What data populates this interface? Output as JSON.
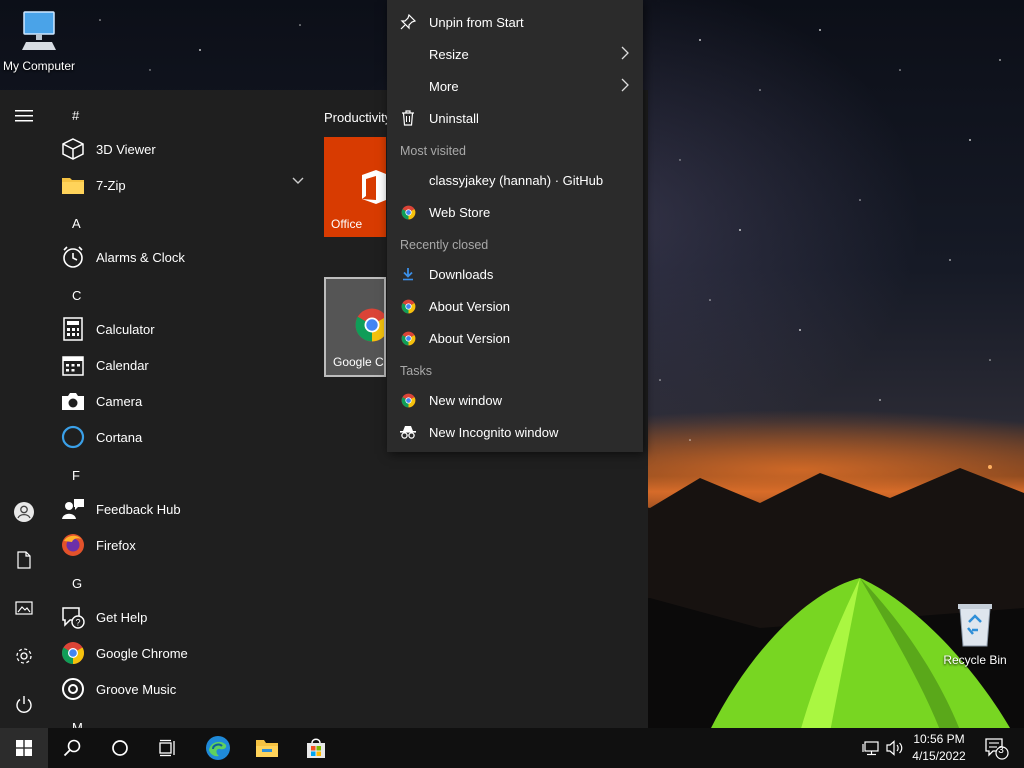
{
  "desktop": {
    "my_computer": "My Computer",
    "recycle_bin": "Recycle Bin"
  },
  "start_menu": {
    "hamburger_icon": "hamburger-menu-icon",
    "rail": [
      "user-icon",
      "document-icon",
      "pictures-icon",
      "settings-icon",
      "power-icon"
    ],
    "groups": {
      "hash": "#",
      "a": "A",
      "c": "C",
      "f": "F",
      "g": "G",
      "m": "M"
    },
    "apps": {
      "viewer3d": "3D Viewer",
      "zip": "7-Zip",
      "alarms": "Alarms & Clock",
      "calculator": "Calculator",
      "calendar": "Calendar",
      "camera": "Camera",
      "cortana": "Cortana",
      "feedback": "Feedback Hub",
      "firefox": "Firefox",
      "gethelp": "Get Help",
      "chrome": "Google Chrome",
      "groove": "Groove Music"
    },
    "tiles_header": "Productivity",
    "tiles": {
      "office": "Office",
      "chrome": "Google Chrome"
    }
  },
  "context_menu": {
    "unpin": "Unpin from Start",
    "resize": "Resize",
    "more": "More",
    "uninstall": "Uninstall",
    "most_visited_header": "Most visited",
    "most_visited": [
      "classyjakey (hannah) · GitHub",
      "Web Store"
    ],
    "recently_closed_header": "Recently closed",
    "recently_closed": [
      "Downloads",
      "About Version",
      "About Version"
    ],
    "tasks_header": "Tasks",
    "tasks": [
      "New window",
      "New Incognito window"
    ]
  },
  "taskbar": {
    "pinned": [
      "start-icon",
      "search-icon",
      "cortana-icon",
      "task-view-icon",
      "edge-icon",
      "file-explorer-icon",
      "store-icon"
    ],
    "time": "10:56 PM",
    "date": "4/15/2022",
    "notification_count": "3"
  },
  "colors": {
    "start_bg": "#1f1f1f",
    "context_bg": "#2b2b2b",
    "office_tile": "#d83b01",
    "taskbar_bg": "#101010"
  }
}
